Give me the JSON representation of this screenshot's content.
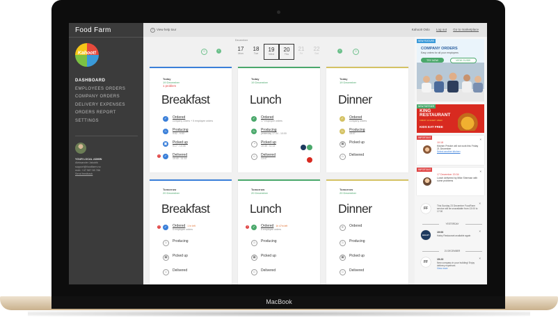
{
  "device": {
    "label": "MacBook"
  },
  "app": {
    "title": "Food Farm",
    "logo_text": "Kahoot!"
  },
  "nav": {
    "items": [
      "DASHBOARD",
      "EMPLOYEES ORDERS",
      "COMPANY ORDERS",
      "DELIVERY EXPENSES",
      "ORDERS REPORT",
      "SETTINGS"
    ]
  },
  "admin": {
    "heading": "YOUR LOCAL ADMIN",
    "name": "Aleksander Jakubik",
    "email": "support@foodfarm.no",
    "phone": "mob: +47 987 98 786",
    "link": "Send feedback"
  },
  "topbar": {
    "help": "View help tour",
    "user": "Kahoot! Oslo",
    "logout": "Log out",
    "marketplace": "Go to marketplace"
  },
  "calendar": {
    "month": "December",
    "days": [
      {
        "num": "17",
        "wd": "Mon"
      },
      {
        "num": "18",
        "wd": "Tue"
      },
      {
        "num": "19",
        "wd": "Wed"
      },
      {
        "num": "20",
        "wd": "Thu"
      },
      {
        "num": "21",
        "wd": "Fri"
      },
      {
        "num": "22",
        "wd": "Sat"
      }
    ],
    "prev": "‹",
    "next": "›"
  },
  "today": {
    "day": "Today",
    "date": "19 December",
    "warning": "1 problem",
    "meals": [
      "Breakfast",
      "Lunch",
      "Dinner"
    ],
    "breakfast": [
      {
        "label": "Ordered",
        "sub": "company orders + 5 employee orders"
      },
      {
        "label": "Producing",
        "sub": "9:52 - 9:53"
      },
      {
        "label": "Picked up",
        "sub": "9:17 - 10:35"
      },
      {
        "label": "Delivered",
        "sub": "10:40 - 11:14"
      }
    ],
    "lunch": [
      {
        "label": "Ordered",
        "sub": "17 employee orders"
      },
      {
        "label": "Producing",
        "sub": "yesterday 17:34 - 10:00"
      },
      {
        "label": "Picked up",
        "sub": "10:45 - 11:13"
      },
      {
        "label": "Delivered",
        "sub": "13:47"
      }
    ],
    "dinner": [
      {
        "label": "Ordered",
        "sub": "company orders"
      },
      {
        "label": "Producing",
        "sub": "15:07"
      },
      {
        "label": "Picked up",
        "sub": ""
      },
      {
        "label": "Delivered",
        "sub": ""
      }
    ]
  },
  "tomorrow": {
    "day": "Tomorrow",
    "date": "20 December",
    "meals": [
      "Breakfast",
      "Lunch",
      "Dinner"
    ],
    "breakfast": [
      {
        "label": "Ordered",
        "sub": "5 employee orders",
        "late": "1 hr left"
      },
      {
        "label": "Producing",
        "sub": ""
      },
      {
        "label": "Picked up",
        "sub": ""
      },
      {
        "label": "Delivered",
        "sub": ""
      }
    ],
    "lunch": [
      {
        "label": "Ordered",
        "sub": "5 employee orders",
        "late": "1h 47m left"
      },
      {
        "label": "Producing",
        "sub": ""
      },
      {
        "label": "Picked up",
        "sub": ""
      },
      {
        "label": "Delivered",
        "sub": ""
      }
    ],
    "dinner": [
      {
        "label": "Ordered",
        "sub": ""
      },
      {
        "label": "Producing",
        "sub": ""
      },
      {
        "label": "Picked up",
        "sub": ""
      },
      {
        "label": "Delivered",
        "sub": ""
      }
    ]
  },
  "ads": {
    "company": {
      "tag": "NEW FEATURE",
      "title": "COMPANY ORDERS",
      "subtitle": "Easy orders for all your employees",
      "try": "TRY NOW",
      "view": "VIEW GUIDE"
    },
    "king": {
      "tag": "NEW PARTNER",
      "title1": "KING",
      "title2": "RESTAURANT",
      "subtitle": "FRIDAY 10 EVERY WEEK",
      "kids": "KIDS EAT FREE"
    }
  },
  "notices": [
    {
      "tag": "IMPORTANT",
      "time": "10:18",
      "msg": "Kitchen Preobe will not work this Friday 21 December",
      "link": "Select another kitchen"
    },
    {
      "tag": "IMPORTANT",
      "time": "17 December 20:34",
      "msg": "Lunch delivered by Mike Sherman with some problems",
      "link": ""
    }
  ],
  "feed": {
    "items": [
      {
        "icon": "FF",
        "time": "",
        "msg": "This Sunday 23 December FoodFarm service will be unavailable from 13:00 to 17:00",
        "link": ""
      },
      {
        "icon": "HALEY",
        "time": "19:06",
        "msg": "Haley Restaurant available again",
        "link": ""
      },
      {
        "icon": "FF",
        "time": "15:23",
        "msg": "New company in your building! Enjoy delivery expenses",
        "link": "View more"
      }
    ],
    "sep1": "YESTERDAY",
    "sep2": "21 DECEMBER"
  },
  "colors": {
    "accent": "#4aa86b",
    "breakfast": "#3a7fd9",
    "lunch": "#4aa86b",
    "dinner": "#d4c264",
    "alert": "#e04545",
    "sidebar": "#3b3b3b"
  }
}
